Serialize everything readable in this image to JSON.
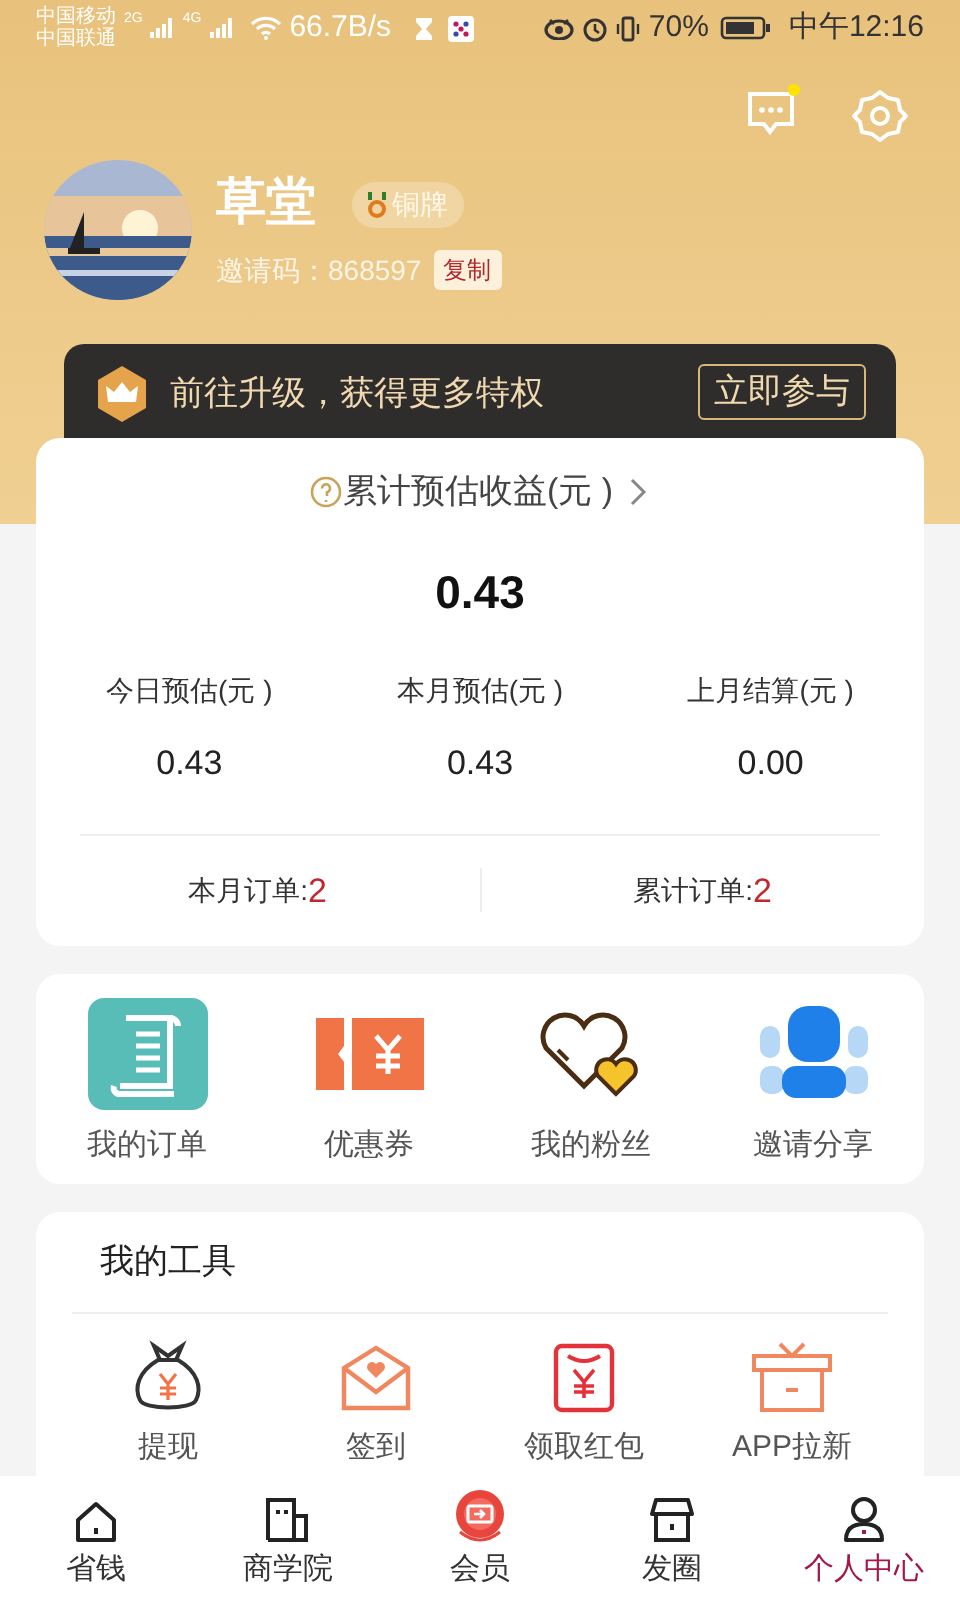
{
  "status_bar": {
    "carrier_1": "中国移动",
    "carrier_2": "中国联通",
    "network_1": "2G",
    "network_2": "4G",
    "speed": "66.7B/s",
    "battery": "70%",
    "time": "中午12:16"
  },
  "header": {
    "messages_unread": true
  },
  "profile": {
    "name": "草堂",
    "badge": "铜牌",
    "invite_label": "邀请码：",
    "invite_code": "868597",
    "copy_button": "复制"
  },
  "banner": {
    "text": "前往升级，获得更多特权",
    "button": "立即参与"
  },
  "earnings": {
    "title": "累计预估收益(元 )",
    "total": "0.43",
    "stats": [
      {
        "label": "今日预估(元 )",
        "value": "0.43"
      },
      {
        "label": "本月预估(元 )",
        "value": "0.43"
      },
      {
        "label": "上月结算(元 )",
        "value": "0.00"
      }
    ],
    "orders": [
      {
        "label": "本月订单:",
        "value": "2"
      },
      {
        "label": "累计订单:",
        "value": "2"
      }
    ]
  },
  "shortcuts": [
    {
      "kind": "orders",
      "label": "我的订单"
    },
    {
      "kind": "coupon",
      "label": "优惠券"
    },
    {
      "kind": "fans",
      "label": "我的粉丝"
    },
    {
      "kind": "invite",
      "label": "邀请分享"
    }
  ],
  "tools": {
    "title": "我的工具",
    "items": [
      {
        "kind": "withdraw",
        "label": "提现"
      },
      {
        "kind": "checkin",
        "label": "签到"
      },
      {
        "kind": "redpacket",
        "label": "领取红包"
      },
      {
        "kind": "gift",
        "label": "APP拉新"
      }
    ]
  },
  "tab_bar": [
    {
      "kind": "home",
      "label": "省钱",
      "selected": false
    },
    {
      "kind": "school",
      "label": "商学院",
      "selected": false
    },
    {
      "kind": "member",
      "label": "会员",
      "selected": false
    },
    {
      "kind": "shop",
      "label": "发圈",
      "selected": false
    },
    {
      "kind": "user",
      "label": "个人中心",
      "selected": true
    }
  ]
}
